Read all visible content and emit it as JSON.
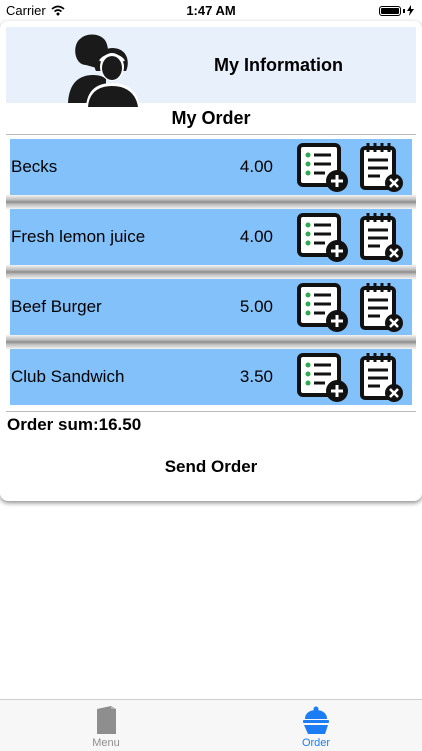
{
  "status_bar": {
    "carrier": "Carrier",
    "time": "1:47 AM"
  },
  "header": {
    "title": "My Information"
  },
  "order": {
    "title": "My Order",
    "items": [
      {
        "name": "Becks",
        "price": "4.00"
      },
      {
        "name": "Fresh lemon juice",
        "price": "4.00"
      },
      {
        "name": "Beef Burger",
        "price": "5.00"
      },
      {
        "name": "Club Sandwich",
        "price": "3.50"
      }
    ],
    "sum_label": "Order sum:16.50",
    "send_label": "Send Order"
  },
  "tab_bar": {
    "tabs": [
      {
        "label": "Menu",
        "icon": "menu-icon",
        "selected": false
      },
      {
        "label": "Order",
        "icon": "waiter-icon",
        "selected": true
      }
    ]
  },
  "colors": {
    "item_background": "#83c1fb",
    "banner_background": "#e8f0fb",
    "tab_selected": "#1c7cf4",
    "tab_unselected": "#8e8e8e"
  }
}
